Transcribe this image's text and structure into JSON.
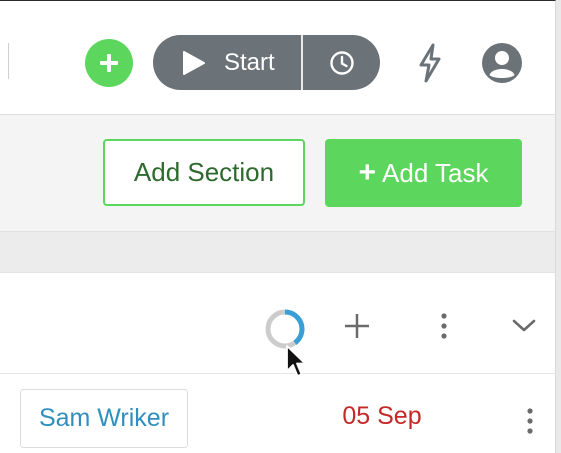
{
  "colors": {
    "accent_green": "#5cd65c",
    "timer_gray": "#6b7378",
    "assignee_blue": "#2f8fbf",
    "due_red": "#c62828",
    "progress_blue": "#3a9fd6",
    "progress_track": "#cccccc"
  },
  "header": {
    "add_icon": "plus-icon",
    "timer": {
      "start_label": "Start",
      "play_icon": "play-icon",
      "clock_icon": "clock-icon"
    },
    "bolt_icon": "lightning-bolt-icon",
    "avatar_icon": "user-avatar-icon"
  },
  "toolbar": {
    "add_section_label": "Add Section",
    "add_task_label": "Add Task",
    "add_task_plus": "+"
  },
  "section": {
    "progress_fraction": 0.4,
    "add_icon": "plus-icon",
    "menu_icon": "kebab-menu-icon",
    "collapse_icon": "chevron-down-icon"
  },
  "task": {
    "assignee": "Sam Wriker",
    "due_date": "05 Sep",
    "menu_icon": "kebab-menu-icon"
  }
}
